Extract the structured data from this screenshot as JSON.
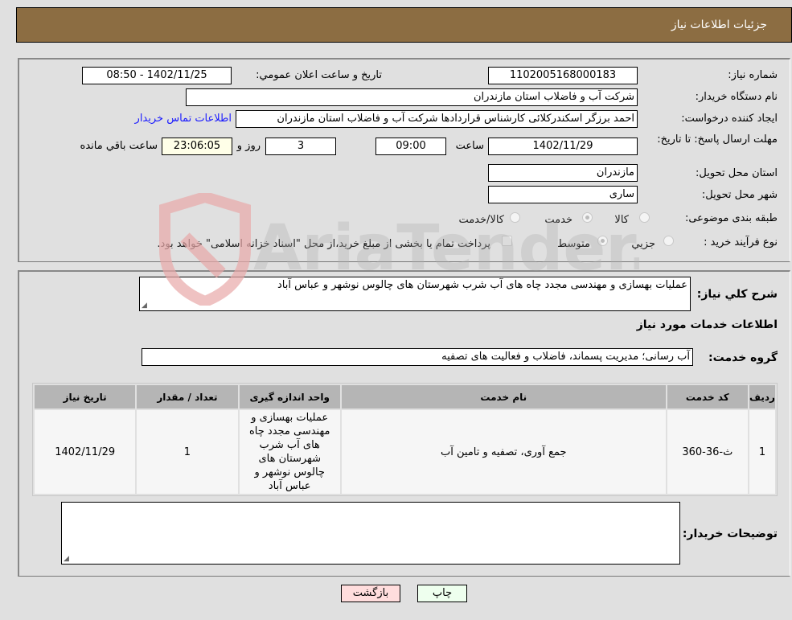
{
  "header": {
    "title": "جزئیات اطلاعات نیاز"
  },
  "details": {
    "need_number_label": "شماره نیاز:",
    "need_number": "1102005168000183",
    "announce_label": "تاریخ و ساعت اعلان عمومي:",
    "announce_value": "1402/11/25 - 08:50",
    "buyer_org_label": "نام دستگاه خریدار:",
    "buyer_org": "شرکت آب و فاضلاب استان مازندران",
    "requester_label": "ایجاد کننده درخواست:",
    "requester": "احمد برزگر اسکندرکلائی کارشناس قراردادها شرکت آب و فاضلاب استان مازندران",
    "contact_link": "اطلاعات تماس خریدار",
    "deadline_label": "مهلت ارسال پاسخ: تا تاریخ:",
    "deadline_date": "1402/11/29",
    "time_label": "ساعت",
    "deadline_time": "09:00",
    "days_value": "3",
    "days_label": "روز و",
    "remaining_time": "23:06:05",
    "remaining_label": "ساعت باقي مانده",
    "province_label": "استان محل تحویل:",
    "province": "مازندران",
    "city_label": "شهر محل تحویل:",
    "city": "ساری",
    "category_label": "طبقه بندی موضوعی:",
    "category_options": [
      "کالا",
      "خدمت",
      "کالا/خدمت"
    ],
    "category_selected": "خدمت",
    "process_label": "نوع فرآیند خرید :",
    "process_options": [
      "جزیي",
      "متوسط"
    ],
    "process_selected": "متوسط",
    "treasury_note": "پرداخت تمام یا بخشی از مبلغ خرید،از محل \"اسناد خزانه اسلامی\" خواهد بود."
  },
  "description": {
    "label": "شرح کلي نیاز:",
    "value": "عملیات بهسازی و مهندسی مجدد چاه های آب شرب شهرستان های چالوس نوشهر و عباس آباد"
  },
  "services": {
    "section_title": "اطلاعات خدمات مورد نیاز",
    "group_label": "گروه خدمت:",
    "group_value": "آب رسانی؛ مدیریت پسماند، فاضلاب و فعالیت های تصفیه",
    "table": {
      "headers": [
        "ردیف",
        "کد خدمت",
        "نام خدمت",
        "واحد اندازه گیری",
        "تعداد / مقدار",
        "تاریخ نیاز"
      ],
      "rows": [
        {
          "row": "1",
          "code": "ث-36-360",
          "name": "جمع آوری، تصفیه و تامین آب",
          "unit": "عملیات بهسازی و مهندسی مجدد چاه های آب شرب شهرستان های چالوس نوشهر و عباس آباد",
          "quantity": "1",
          "date": "1402/11/29"
        }
      ]
    }
  },
  "buyer_notes": {
    "label": "توضیحات خریدار:",
    "value": ""
  },
  "buttons": {
    "print": "چاپ",
    "back": "بازگشت"
  },
  "watermark": {
    "text": "AriaTender.neT"
  }
}
